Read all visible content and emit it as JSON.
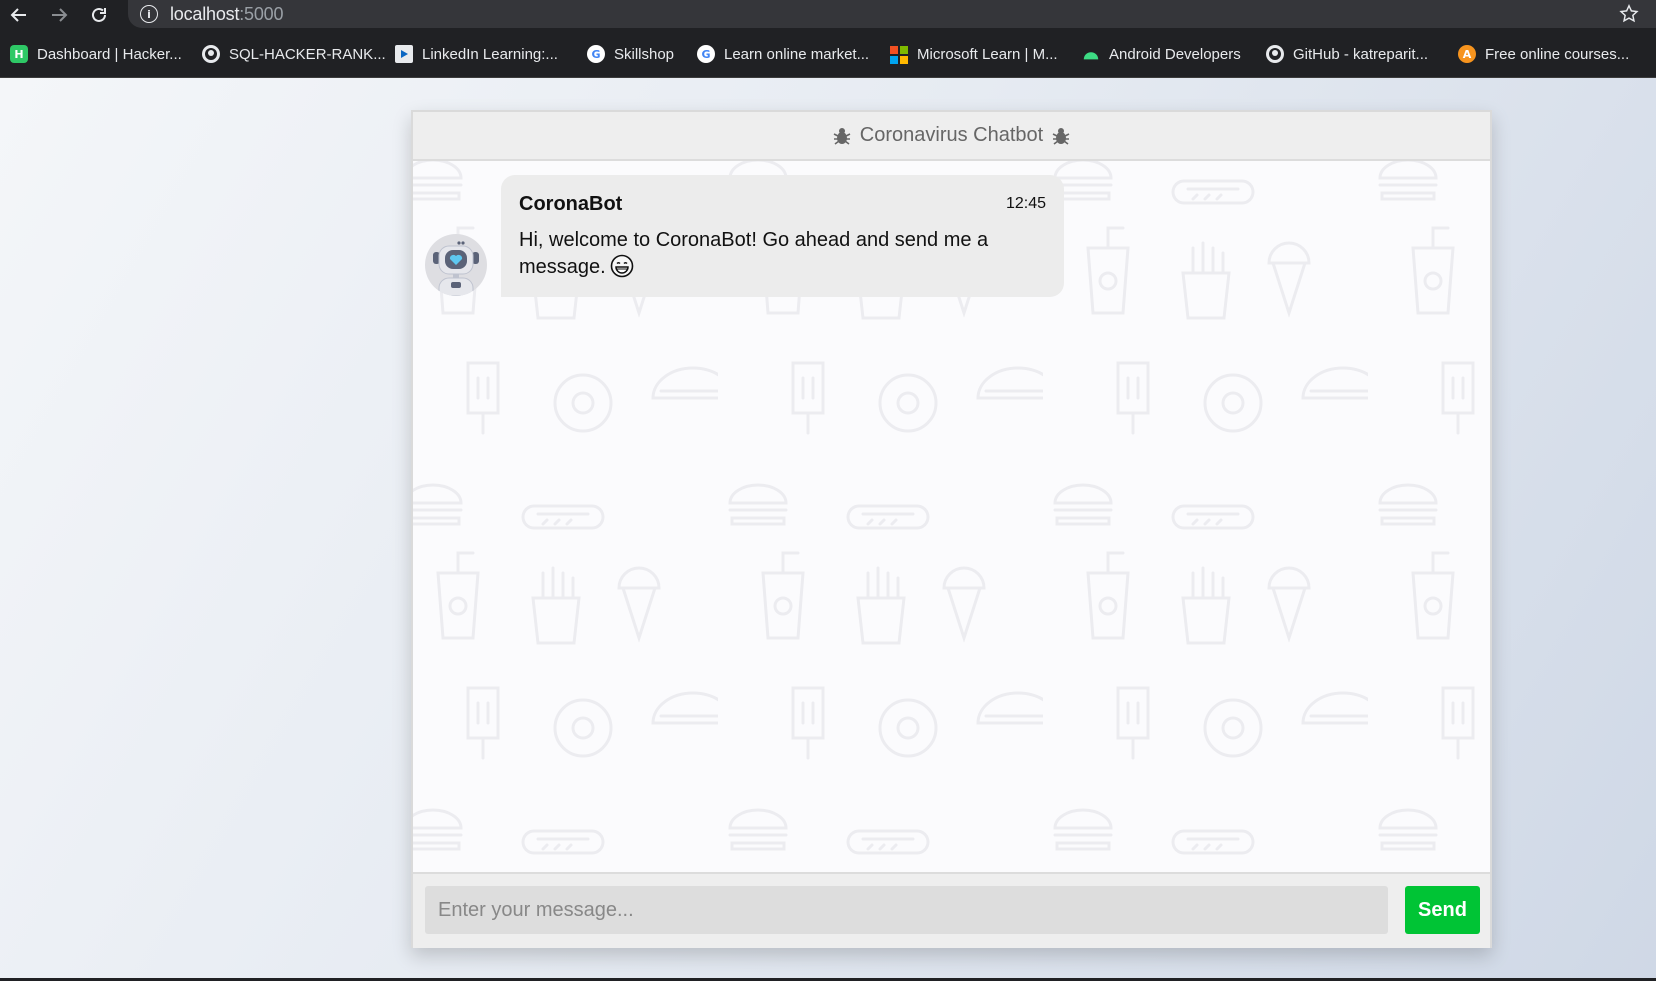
{
  "browser": {
    "url_host": "localhost",
    "url_port": ":5000",
    "bookmarks": [
      {
        "label": "Dashboard | Hacker...",
        "icon": "hackerrank-icon"
      },
      {
        "label": "SQL-HACKER-RANK...",
        "icon": "github-icon"
      },
      {
        "label": "LinkedIn Learning:...",
        "icon": "linkedin-learning-icon"
      },
      {
        "label": "Skillshop",
        "icon": "google-icon"
      },
      {
        "label": "Learn online market...",
        "icon": "google-icon"
      },
      {
        "label": "Microsoft Learn | M...",
        "icon": "microsoft-icon"
      },
      {
        "label": "Android Developers",
        "icon": "android-icon"
      },
      {
        "label": "GitHub - katreparit...",
        "icon": "github-icon"
      },
      {
        "label": "Free online courses...",
        "icon": "free-courses-icon"
      }
    ]
  },
  "chat": {
    "title": "Coronavirus Chatbot",
    "messages": [
      {
        "sender": "CoronaBot",
        "time": "12:45",
        "text": "Hi, welcome to CoronaBot! Go ahead and send me a message."
      }
    ],
    "input_placeholder": "Enter your message...",
    "send_label": "Send"
  },
  "colors": {
    "send_button": "#00c435",
    "header_bg": "#eeeeee",
    "bubble_bg": "#ececec",
    "browser_bg": "#202124"
  }
}
